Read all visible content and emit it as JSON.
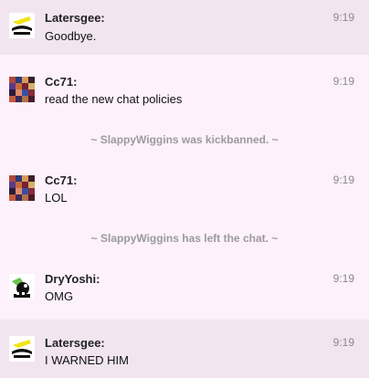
{
  "messages": [
    {
      "user": "Latersgee:",
      "text": "Goodbye.",
      "time": "9:19",
      "avatar": "yellow-dragon-avatar"
    },
    {
      "user": "Cc71:",
      "text": "read the new chat policies",
      "time": "9:19",
      "avatar": "pixel-crowd-avatar"
    },
    {
      "inline": "SlappyWiggins was kickbanned."
    },
    {
      "user": "Cc71:",
      "text": "LOL",
      "time": "9:19",
      "avatar": "pixel-crowd-avatar"
    },
    {
      "inline": "SlappyWiggins has left the chat."
    },
    {
      "user": "DryYoshi:",
      "text": "OMG",
      "time": "9:19",
      "avatar": "dry-yoshi-avatar"
    },
    {
      "user": "Latersgee:",
      "text": "I WARNED HIM",
      "time": "9:19",
      "avatar": "yellow-dragon-avatar"
    }
  ],
  "inline_prefix": "~",
  "inline_suffix": "~",
  "colors": {
    "background": "#fdf1fc",
    "highlight": "#f1e5f0",
    "inline_text": "#9b9b9b"
  }
}
